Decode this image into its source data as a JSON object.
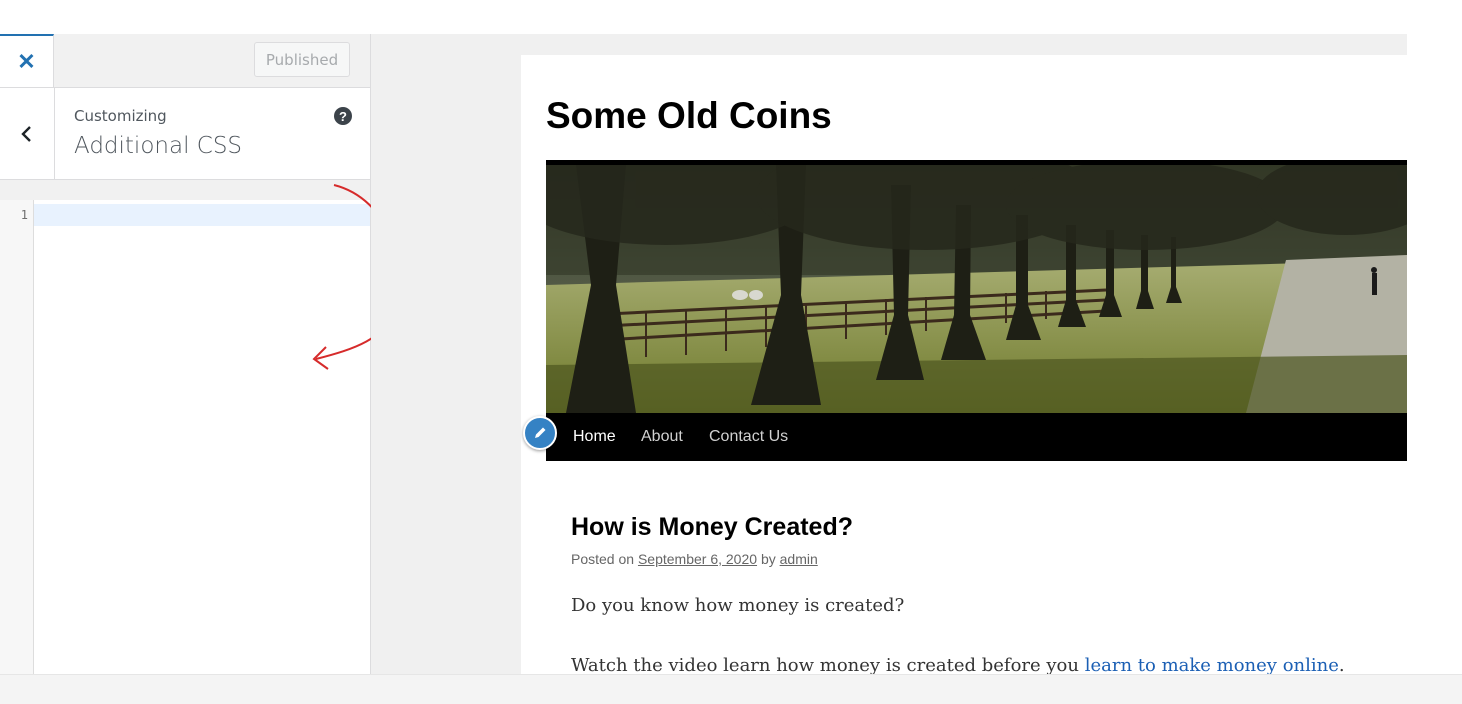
{
  "customizer": {
    "publish_label": "Published",
    "customizing_label": "Customizing",
    "section_title": "Additional CSS",
    "editor_line_number": "1",
    "help_symbol": "?",
    "close_symbol": "✕"
  },
  "site": {
    "title": "Some Old Coins",
    "nav": [
      "Home",
      "About",
      "Contact Us"
    ],
    "post": {
      "title": "How is Money Created?",
      "meta_prefix": "Posted on",
      "date": "September 6, 2020",
      "meta_by": "by",
      "author": "admin",
      "paragraph1": "Do you know how money is created?",
      "paragraph2_text": "Watch the video learn how money is created before you",
      "paragraph2_link": "learn to make money online",
      "paragraph2_end": "."
    }
  },
  "colors": {
    "accent": "#2271b1",
    "annotation_arrow": "#d62b2b",
    "link": "#1b5fb4",
    "nav_bg": "#000000"
  }
}
